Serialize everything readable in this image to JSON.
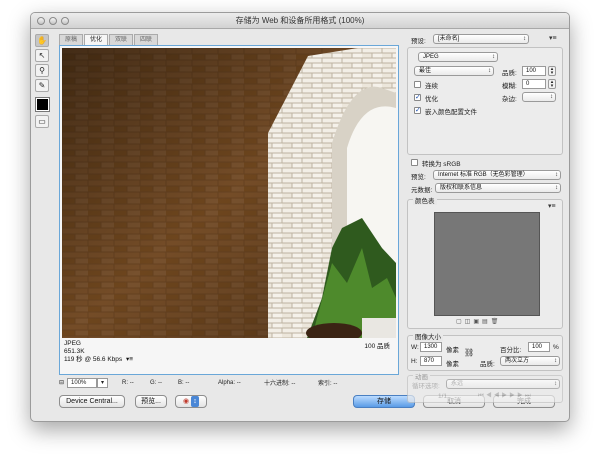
{
  "window": {
    "title": "存储为 Web 和设备所用格式 (100%)"
  },
  "tabs": [
    {
      "label": "原稿"
    },
    {
      "label": "优化"
    },
    {
      "label": "双联"
    },
    {
      "label": "四联"
    }
  ],
  "preview": {
    "format": "JPEG",
    "size": "651.3K",
    "time": "119 秒 @ 56.6 Kbps",
    "quality": "100 品质"
  },
  "statusbar": {
    "zoom": "100%",
    "r": "R: --",
    "g": "G: --",
    "b": "B: --",
    "alpha": "Alpha: --",
    "hex": "十六进制: --",
    "index": "索引: --"
  },
  "buttons": {
    "device_central": "Device Central...",
    "preview": "预览...",
    "save": "存储",
    "cancel": "取消",
    "done": "完成"
  },
  "settings": {
    "preset_label": "预设:",
    "preset_value": "[未命名]",
    "format": "JPEG",
    "quality_mode": "最佳",
    "quality_label": "品质:",
    "quality_value": "100",
    "progressive_label": "连续",
    "blur_label": "模糊:",
    "blur_value": "0",
    "optimized_label": "优化",
    "matte_label": "杂边:",
    "embed_profile_label": "嵌入颜色配置文件",
    "convert_srgb_label": "转换为 sRGB",
    "preview_label": "预览:",
    "preview_value": "Internet 标准 RGB（无色彩管理）",
    "metadata_label": "元数据:",
    "metadata_value": "版权和联系信息"
  },
  "color_table": {
    "title": "颜色表"
  },
  "image_size": {
    "title": "图像大小",
    "w_label": "W:",
    "w_value": "1300",
    "h_label": "H:",
    "h_value": "870",
    "unit": "像素",
    "percent_label": "百分比:",
    "percent_value": "100",
    "percent_unit": "%",
    "quality_label": "品质:",
    "quality_value": "两次立方"
  },
  "animation": {
    "title": "动画",
    "loop_label": "循环选项:",
    "loop_value": "永远",
    "frame_counter": "1/1"
  },
  "colors": {
    "accent": "#5a9be6",
    "frame_border": "#6aa7d8",
    "color_table_fill": "#777777"
  }
}
